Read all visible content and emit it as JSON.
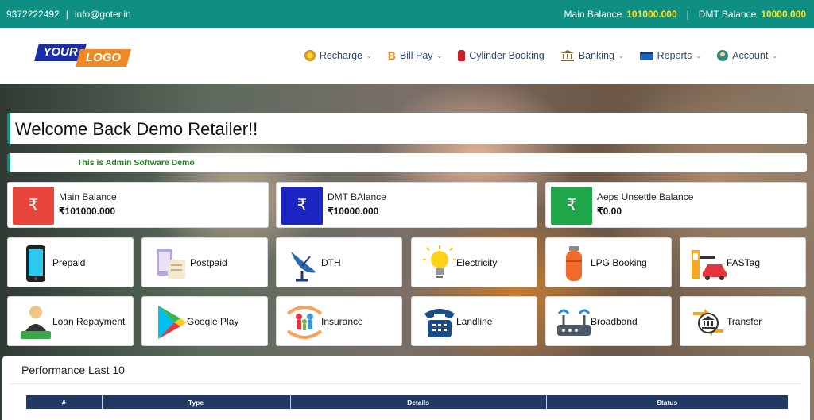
{
  "topbar": {
    "phone": "9372222492",
    "separator": "|",
    "email": "info@goter.in",
    "main_balance_label": "Main Balance",
    "main_balance_value": "101000.000",
    "dmt_balance_label": "DMT Balance",
    "dmt_balance_value": "10000.000"
  },
  "logo": {
    "part1": "YOUR",
    "part2": "LOGO"
  },
  "menu": [
    {
      "label": "Recharge",
      "icon": "recharge-icon",
      "caret": "⌄"
    },
    {
      "label": "Bill Pay",
      "icon": "bill-pay-icon",
      "caret": "⌄"
    },
    {
      "label": "Cylinder Booking",
      "icon": "cylinder-icon",
      "caret": ""
    },
    {
      "label": "Banking",
      "icon": "banking-icon",
      "caret": "⌄"
    },
    {
      "label": "Reports",
      "icon": "reports-icon",
      "caret": "⌄"
    },
    {
      "label": "Account",
      "icon": "account-icon",
      "caret": "⌄"
    }
  ],
  "welcome": "Welcome Back Demo Retailer!!",
  "notice": "This is Admin Software Demo",
  "balances": [
    {
      "label": "Main Balance",
      "value": "₹101000.000",
      "symbol": "₹",
      "color": "#e8453c"
    },
    {
      "label": "DMT BAlance",
      "value": "₹10000.000",
      "symbol": "₹",
      "color": "#1b25c2"
    },
    {
      "label": "Aeps Unsettle Balance",
      "value": "₹0.00",
      "symbol": "₹",
      "color": "#1fa54a"
    }
  ],
  "services_row1": [
    {
      "label": "Prepaid",
      "icon": "mobile-phone-icon"
    },
    {
      "label": "Postpaid",
      "icon": "postpaid-bill-icon"
    },
    {
      "label": "DTH",
      "icon": "satellite-dish-icon"
    },
    {
      "label": "Electricity",
      "icon": "light-bulb-icon"
    },
    {
      "label": "LPG Booking",
      "icon": "gas-cylinder-icon"
    },
    {
      "label": "FASTag",
      "icon": "fastag-toll-icon"
    }
  ],
  "services_row2": [
    {
      "label": "Loan Repayment",
      "icon": "loan-person-icon"
    },
    {
      "label": "Google Play",
      "icon": "google-play-icon"
    },
    {
      "label": "Insurance",
      "icon": "family-insurance-icon"
    },
    {
      "label": "Landline",
      "icon": "landline-phone-icon"
    },
    {
      "label": "Broadband",
      "icon": "router-icon"
    },
    {
      "label": "Transfer",
      "icon": "bank-transfer-icon"
    }
  ],
  "performance": {
    "title": "Performance Last 10",
    "columns": [
      "#",
      "Type",
      "Details",
      "Status"
    ]
  },
  "colors": {
    "topbar": "#0e8f82",
    "balance_value": "#ffe01a",
    "menu_text": "#2a4a78",
    "notice_text": "#1a8a1a",
    "table_header": "#223a63"
  }
}
